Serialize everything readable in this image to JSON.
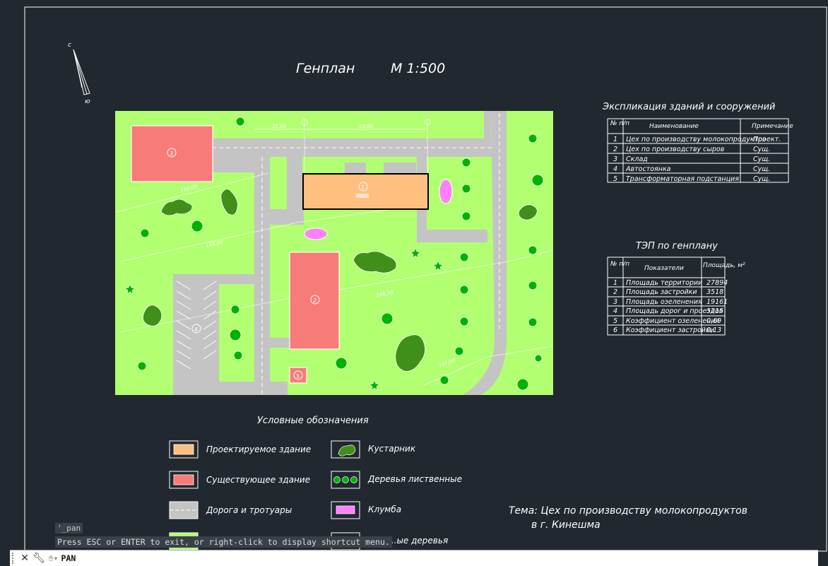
{
  "drawing": {
    "title": "Генплан",
    "scale": "М 1:500",
    "north_label": "с",
    "south_label": "ю",
    "site": {
      "building_labels": [
        "1",
        "2",
        "3",
        "4",
        "5"
      ],
      "dimension_labels": [
        "21,00",
        "33,00",
        "150,00",
        "149,00",
        "148,50",
        "147,00"
      ]
    },
    "explication": {
      "title": "Экспликация зданий и сооружений",
      "headers": [
        "№ п/п",
        "Наименование",
        "Примечание"
      ],
      "rows": [
        [
          "1",
          "Цех по производству молокопродуктов",
          "Проект."
        ],
        [
          "2",
          "Цех по производству сыров",
          "Сущ."
        ],
        [
          "3",
          "Склад",
          "Сущ."
        ],
        [
          "4",
          "Автостоянка",
          "Сущ."
        ],
        [
          "5",
          "Трансформаторная подстанция",
          "Сущ."
        ]
      ]
    },
    "tep": {
      "title": "ТЭП по генплану",
      "headers": [
        "№ п/п",
        "Показатели",
        "Площадь, м²"
      ],
      "rows": [
        [
          "1",
          "Площадь территории",
          "27894"
        ],
        [
          "2",
          "Площадь застройки",
          "3518"
        ],
        [
          "3",
          "Площадь озеленения",
          "19161"
        ],
        [
          "4",
          "Площадь дорог и проездов",
          "5215"
        ],
        [
          "5",
          "Коэффициент озеленения",
          "0,69"
        ],
        [
          "6",
          "Коэффициент застройки",
          "0,13"
        ]
      ]
    },
    "legend": {
      "title": "Условные обозначения",
      "items": [
        {
          "icon": "designed-building-swatch",
          "label": "Проектируемое здание"
        },
        {
          "icon": "existing-building-swatch",
          "label": "Существующее здание"
        },
        {
          "icon": "road-swatch",
          "label": "Дорога и тротуары"
        },
        {
          "icon": "shrub-icon",
          "label": "Кустарник"
        },
        {
          "icon": "deciduous-trees-icon",
          "label": "Деревья лиственные"
        },
        {
          "icon": "flowerbed-swatch",
          "label": "Клумба"
        },
        {
          "icon": "conifer-trees-icon",
          "label": "...ые деревья"
        }
      ]
    },
    "theme": {
      "line1": "Тема:  Цех по производству молокопродуктов",
      "line2": "в г. Кинешма"
    },
    "colors": {
      "background": "#212830",
      "grass": "#b3ff72",
      "designed_building": "#ffbf80",
      "existing_building": "#f77b79",
      "road": "#c4c4c4",
      "tree": "#00b300",
      "flowerbed": "#ff80ff"
    }
  },
  "command_line": {
    "history": "'_pan",
    "message": "Press ESC or ENTER to exit, or right-click to display shortcut menu.",
    "input": "PAN"
  }
}
